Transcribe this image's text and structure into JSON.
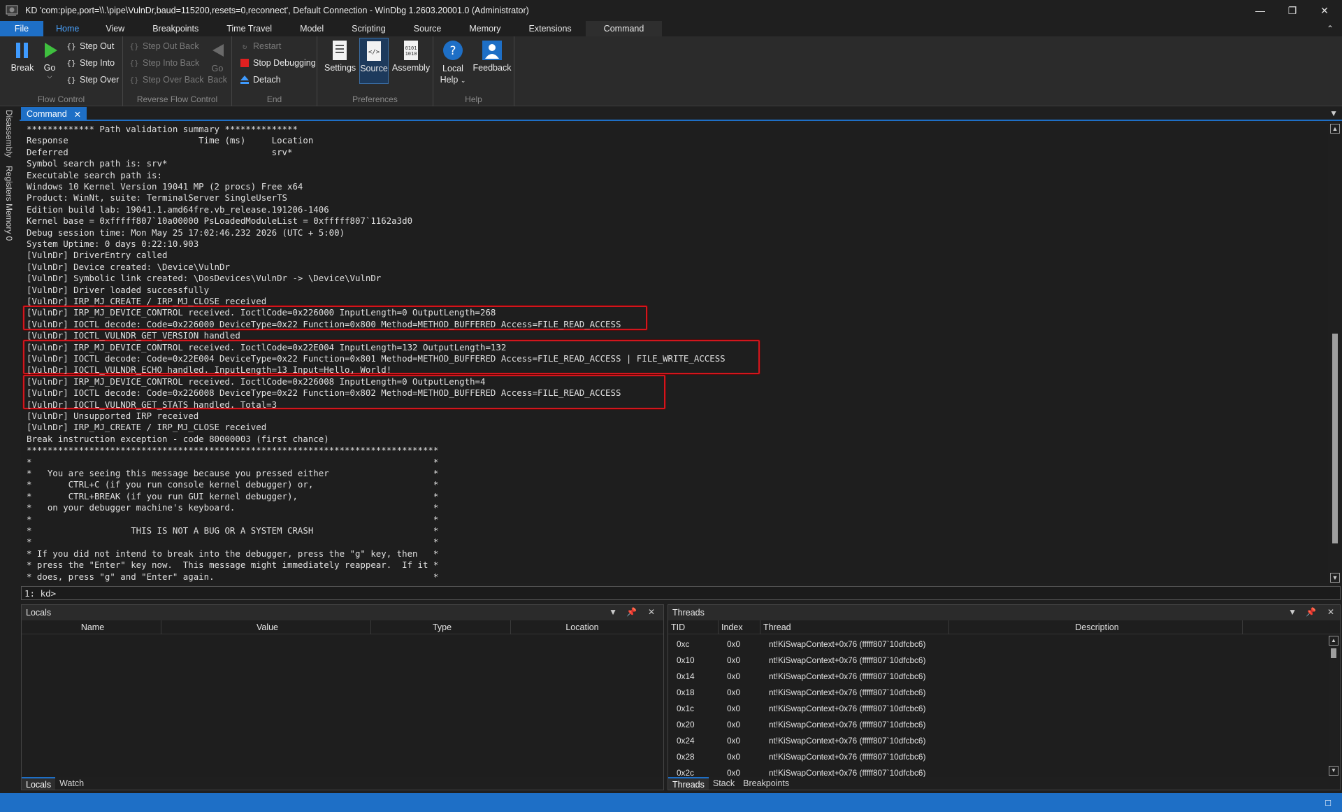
{
  "window": {
    "title": "KD 'com:pipe,port=\\\\.\\pipe\\VulnDr,baud=115200,resets=0,reconnect', Default Connection  - WinDbg 1.2603.20001.0 (Administrator)",
    "controls": [
      "—",
      "❐",
      "✕"
    ]
  },
  "ribbon_tabs": [
    "File",
    "Home",
    "View",
    "Breakpoints",
    "Time Travel",
    "Model",
    "Scripting",
    "Source",
    "Memory",
    "Extensions",
    "Command"
  ],
  "ribbon": {
    "flow_control": {
      "label": "Flow Control",
      "break": "Break",
      "go": "Go",
      "step_out": "Step Out",
      "step_into": "Step Into",
      "step_over": "Step Over"
    },
    "reverse_flow": {
      "label": "Reverse Flow Control",
      "step_out_back": "Step Out Back",
      "step_into_back": "Step Into Back",
      "step_over_back": "Step Over Back",
      "go_back": "Go Back"
    },
    "end": {
      "label": "End",
      "restart": "Restart",
      "stop": "Stop Debugging",
      "detach": "Detach"
    },
    "preferences": {
      "label": "Preferences",
      "settings": "Settings",
      "source": "Source",
      "assembly": "Assembly"
    },
    "help": {
      "label": "Help",
      "local_help": "Local Help",
      "feedback": "Feedback"
    }
  },
  "left_tabs": [
    "Disassembly",
    "Registers",
    "Memory 0"
  ],
  "command": {
    "tab": "Command",
    "prompt": "1: kd>",
    "input_value": "",
    "lines": [
      "************* Path validation summary **************",
      "Response                         Time (ms)     Location",
      "Deferred                                       srv*",
      "Symbol search path is: srv*",
      "Executable search path is: ",
      "Windows 10 Kernel Version 19041 MP (2 procs) Free x64",
      "Product: WinNt, suite: TerminalServer SingleUserTS",
      "Edition build lab: 19041.1.amd64fre.vb_release.191206-1406",
      "Kernel base = 0xfffff807`10a00000 PsLoadedModuleList = 0xfffff807`1162a3d0",
      "Debug session time: Mon May 25 17:02:46.232 2026 (UTC + 5:00)",
      "System Uptime: 0 days 0:22:10.903",
      "[VulnDr] DriverEntry called",
      "[VulnDr] Device created: \\Device\\VulnDr",
      "[VulnDr] Symbolic link created: \\DosDevices\\VulnDr -> \\Device\\VulnDr",
      "[VulnDr] Driver loaded successfully",
      "[VulnDr] IRP_MJ_CREATE / IRP_MJ_CLOSE received",
      "[VulnDr] IRP_MJ_DEVICE_CONTROL received. IoctlCode=0x226000 InputLength=0 OutputLength=268",
      "[VulnDr] IOCTL decode: Code=0x226000 DeviceType=0x22 Function=0x800 Method=METHOD_BUFFERED Access=FILE_READ_ACCESS",
      "[VulnDr] IOCTL_VULNDR_GET_VERSION handled",
      "[VulnDr] IRP_MJ_DEVICE_CONTROL received. IoctlCode=0x22E004 InputLength=132 OutputLength=132",
      "[VulnDr] IOCTL decode: Code=0x22E004 DeviceType=0x22 Function=0x801 Method=METHOD_BUFFERED Access=FILE_READ_ACCESS | FILE_WRITE_ACCESS",
      "[VulnDr] IOCTL_VULNDR_ECHO handled. InputLength=13 Input=Hello, World!",
      "[VulnDr] IRP_MJ_DEVICE_CONTROL received. IoctlCode=0x226008 InputLength=0 OutputLength=4",
      "[VulnDr] IOCTL decode: Code=0x226008 DeviceType=0x22 Function=0x802 Method=METHOD_BUFFERED Access=FILE_READ_ACCESS",
      "[VulnDr] IOCTL_VULNDR_GET_STATS handled. Total=3",
      "[VulnDr] Unsupported IRP received",
      "[VulnDr] IRP_MJ_CREATE / IRP_MJ_CLOSE received",
      "Break instruction exception - code 80000003 (first chance)",
      "*******************************************************************************",
      "*                                                                             *",
      "*   You are seeing this message because you pressed either                    *",
      "*       CTRL+C (if you run console kernel debugger) or,                       *",
      "*       CTRL+BREAK (if you run GUI kernel debugger),                          *",
      "*   on your debugger machine's keyboard.                                      *",
      "*                                                                             *",
      "*                   THIS IS NOT A BUG OR A SYSTEM CRASH                       *",
      "*                                                                             *",
      "* If you did not intend to break into the debugger, press the \"g\" key, then   *",
      "* press the \"Enter\" key now.  This message might immediately reappear.  If it *",
      "* does, press \"g\" and \"Enter\" again.                                          *"
    ]
  },
  "locals": {
    "title": "Locals",
    "columns": [
      "Name",
      "Value",
      "Type",
      "Location"
    ],
    "tabs": [
      "Locals",
      "Watch"
    ]
  },
  "threads": {
    "title": "Threads",
    "columns": [
      "TID",
      "Index",
      "Thread",
      "Description"
    ],
    "rows": [
      {
        "tid": "0xc",
        "index": "0x0",
        "thread": "nt!KiSwapContext+0x76 (fffff807`10dfcbc6)"
      },
      {
        "tid": "0x10",
        "index": "0x0",
        "thread": "nt!KiSwapContext+0x76 (fffff807`10dfcbc6)"
      },
      {
        "tid": "0x14",
        "index": "0x0",
        "thread": "nt!KiSwapContext+0x76 (fffff807`10dfcbc6)"
      },
      {
        "tid": "0x18",
        "index": "0x0",
        "thread": "nt!KiSwapContext+0x76 (fffff807`10dfcbc6)"
      },
      {
        "tid": "0x1c",
        "index": "0x0",
        "thread": "nt!KiSwapContext+0x76 (fffff807`10dfcbc6)"
      },
      {
        "tid": "0x20",
        "index": "0x0",
        "thread": "nt!KiSwapContext+0x76 (fffff807`10dfcbc6)"
      },
      {
        "tid": "0x24",
        "index": "0x0",
        "thread": "nt!KiSwapContext+0x76 (fffff807`10dfcbc6)"
      },
      {
        "tid": "0x28",
        "index": "0x0",
        "thread": "nt!KiSwapContext+0x76 (fffff807`10dfcbc6)"
      },
      {
        "tid": "0x2c",
        "index": "0x0",
        "thread": "nt!KiSwapContext+0x76 (fffff807`10dfcbc6)"
      }
    ],
    "tabs": [
      "Threads",
      "Stack",
      "Breakpoints"
    ]
  },
  "colors": {
    "accent": "#1e6fc6",
    "highlight_border": "#d2161d",
    "background": "#1e1e1e"
  }
}
